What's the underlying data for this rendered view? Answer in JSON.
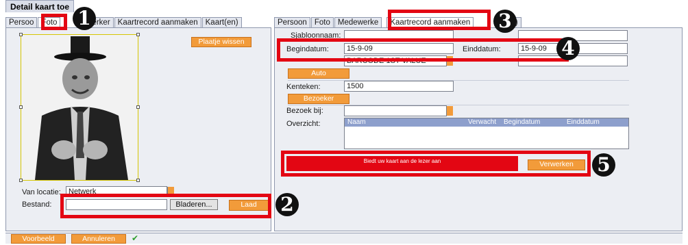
{
  "window": {
    "title": "Detail kaart toe"
  },
  "left": {
    "tabs": [
      "Persoo",
      "Foto",
      "erker",
      "Kaartrecord aanmaken",
      "Kaart(en)"
    ],
    "photo_area": {
      "clear_button": "Plaatje wissen"
    },
    "location": {
      "label": "Van locatie:",
      "value": "Netwerk"
    },
    "file": {
      "label": "Bestand:",
      "value": "",
      "browse_button": "Bladeren...",
      "load_button": "Laad"
    }
  },
  "right": {
    "tabs": [
      "Persoon",
      "Foto",
      "Medewerke",
      "Kaartrecord aanmaken",
      "(en)"
    ],
    "template": {
      "label": "Sjabloonnaam:"
    },
    "begin": {
      "label": "Begindatum:",
      "value": "15-9-09"
    },
    "end": {
      "label": "Einddatum:",
      "value": "15-9-09"
    },
    "codering": {
      "value": "BARCODE 1ST VALUE"
    },
    "auto_button": "Auto",
    "kenteken": {
      "label": "Kenteken:",
      "value": "1500"
    },
    "bezoeker_button": "Bezoeker",
    "bezoek": {
      "label": "Bezoek bij:"
    },
    "overzicht": {
      "label": "Overzicht:",
      "columns": [
        "Naam",
        "Verwacht",
        "Begindatum",
        "Einddatum"
      ]
    },
    "status_text": "Biedt uw kaart aan de lezer aan",
    "process_button": "Verwerken"
  },
  "footer": {
    "preview_button": "Voorbeeld",
    "cancel_button": "Annuleren",
    "status_icon": "checkmark-icon"
  },
  "callouts": [
    "1",
    "2",
    "3",
    "4",
    "5"
  ],
  "colors": {
    "accent": "#f29b3a",
    "callout": "#e30613"
  }
}
